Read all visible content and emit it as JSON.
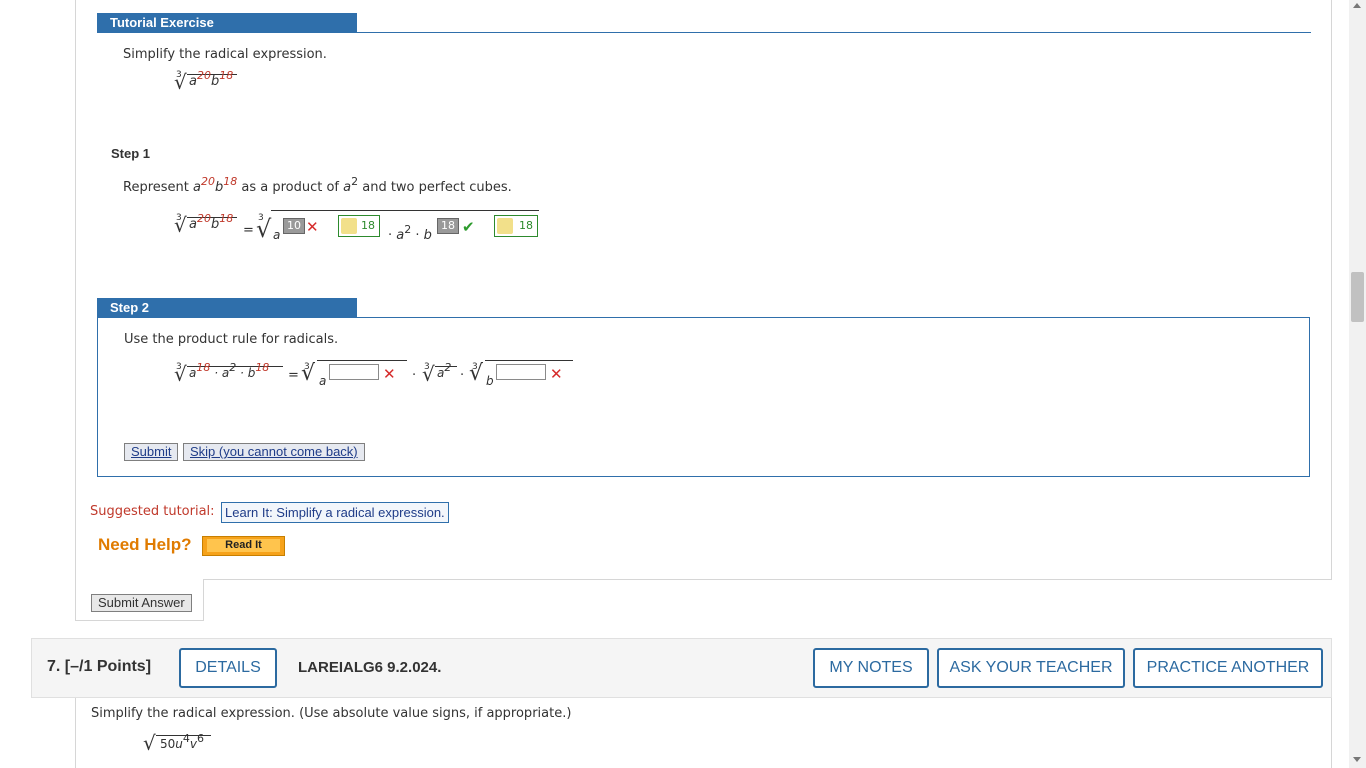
{
  "tutorial": {
    "header": "Tutorial Exercise",
    "prompt": "Simplify the radical expression.",
    "expr": {
      "index": "3",
      "base": "a",
      "exp1": "20",
      "var2": "b",
      "exp2": "18"
    }
  },
  "step1": {
    "label": "Step 1",
    "text_pre": "Represent ",
    "text_mid": " as a product of ",
    "text_a2": "a",
    "text_a2_exp": "2",
    "text_post": " and two perfect cubes.",
    "eq": "=",
    "dot": "·",
    "a_var": "a",
    "b_var": "b",
    "user_a_exp": "10",
    "key_a_exp": "18",
    "user_b_exp": "18",
    "key_b_exp": "18",
    "a2": "a",
    "a2_exp": "2"
  },
  "step2": {
    "header": "Step 2",
    "instruction": "Use the product rule for radicals.",
    "lhs_exp1": "18",
    "lhs_exp2": "2",
    "lhs_exp3": "18",
    "submit": "Submit",
    "skip": "Skip (you cannot come back)"
  },
  "suggested": {
    "label": "Suggested tutorial:",
    "link": "Learn It: Simplify a radical expression."
  },
  "help": {
    "label": "Need Help?",
    "read_it": "Read It"
  },
  "submit_answer": "Submit Answer",
  "question7": {
    "number": "7.",
    "points": "[–/1 Points]",
    "details": "DETAILS",
    "code": "LAREIALG6 9.2.024.",
    "my_notes": "MY NOTES",
    "ask_teacher": "ASK YOUR TEACHER",
    "practice_another": "PRACTICE ANOTHER",
    "prompt": "Simplify the radical expression. (Use absolute value signs, if appropriate.)",
    "expr": {
      "coef": "50",
      "var1": "u",
      "exp1": "4",
      "var2": "v",
      "exp2": "6"
    }
  },
  "icons": {
    "radical": "√",
    "x_mark": "✕",
    "check": "✔"
  },
  "colors": {
    "header_blue": "#2f6fab",
    "red": "#c0392b",
    "orange": "#e07b00",
    "green": "#2d8a2d"
  }
}
